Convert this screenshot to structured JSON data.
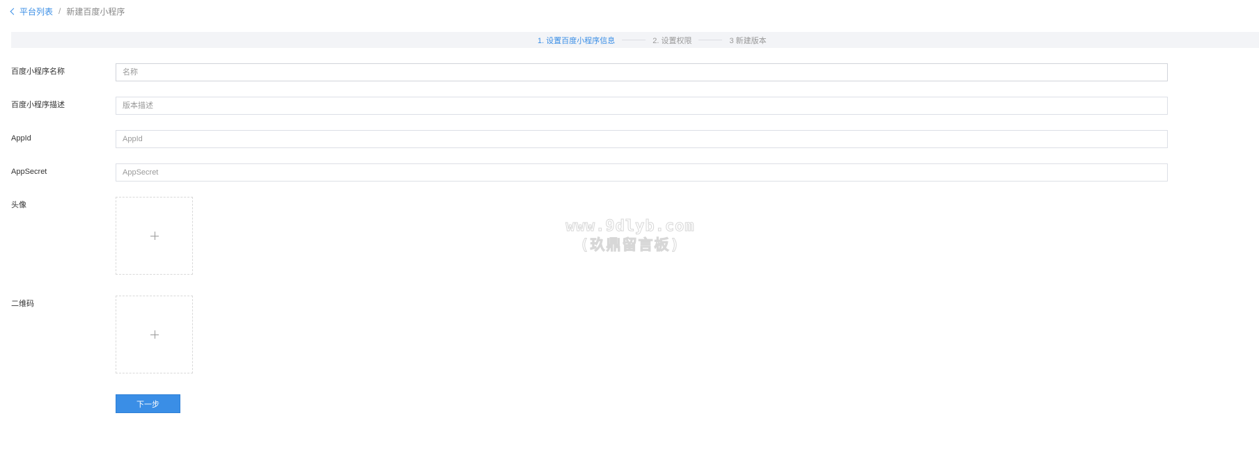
{
  "breadcrumb": {
    "back_label": "平台列表",
    "separator": "/",
    "current": "新建百度小程序"
  },
  "steps": [
    {
      "label": "1. 设置百度小程序信息",
      "active": true
    },
    {
      "label": "2. 设置权限",
      "active": false
    },
    {
      "label": "3 新建版本",
      "active": false
    }
  ],
  "form": {
    "name_label": "百度小程序名称",
    "name_placeholder": "名称",
    "desc_label": "百度小程序描述",
    "desc_placeholder": "版本描述",
    "appid_label": "AppId",
    "appid_placeholder": "AppId",
    "appsecret_label": "AppSecret",
    "appsecret_placeholder": "AppSecret",
    "avatar_label": "头像",
    "qrcode_label": "二维码",
    "upload_icon": "plus-icon",
    "next_label": "下一步"
  },
  "watermark": {
    "line1": "www.9dlyb.com",
    "line2": "(玖鼎留言板)"
  },
  "colors": {
    "accent": "#3a8ee6",
    "steps_bg": "#f3f4f7",
    "border": "#dcdfe6"
  }
}
